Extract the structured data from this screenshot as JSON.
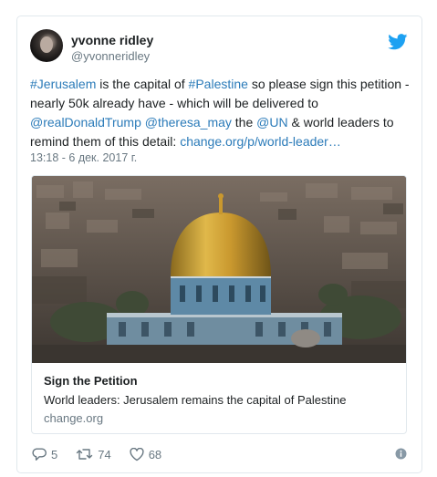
{
  "author": {
    "name": "yvonne ridley",
    "handle": "@yvonneridley"
  },
  "tweet": {
    "parts": [
      {
        "text": "#Jerusalem",
        "link": true
      },
      {
        "text": " is the capital of ",
        "link": false
      },
      {
        "text": "#Palestine",
        "link": true
      },
      {
        "text": " so please sign this petition - nearly 50k already have - which will be delivered to ",
        "link": false
      },
      {
        "text": "@realDonaldTrump",
        "link": true
      },
      {
        "text": " ",
        "link": false
      },
      {
        "text": "@theresa_may",
        "link": true
      },
      {
        "text": " the ",
        "link": false
      },
      {
        "text": "@UN",
        "link": true
      },
      {
        "text": " & world leaders to remind them of this detail: ",
        "link": false
      },
      {
        "text": "change.org/p/world-leader…",
        "link": true
      }
    ],
    "timestamp": "13:18 - 6 дек. 2017 г."
  },
  "card": {
    "title": "Sign the Petition",
    "description": "World leaders: Jerusalem remains the capital of Palestine",
    "domain": "change.org",
    "image_icon": "dome-of-the-rock-photo"
  },
  "actions": {
    "replies": "5",
    "retweets": "74",
    "likes": "68"
  },
  "colors": {
    "link": "#2b7bb9",
    "bird": "#1da1f2",
    "muted": "#697882",
    "border": "#e1e8ed"
  }
}
